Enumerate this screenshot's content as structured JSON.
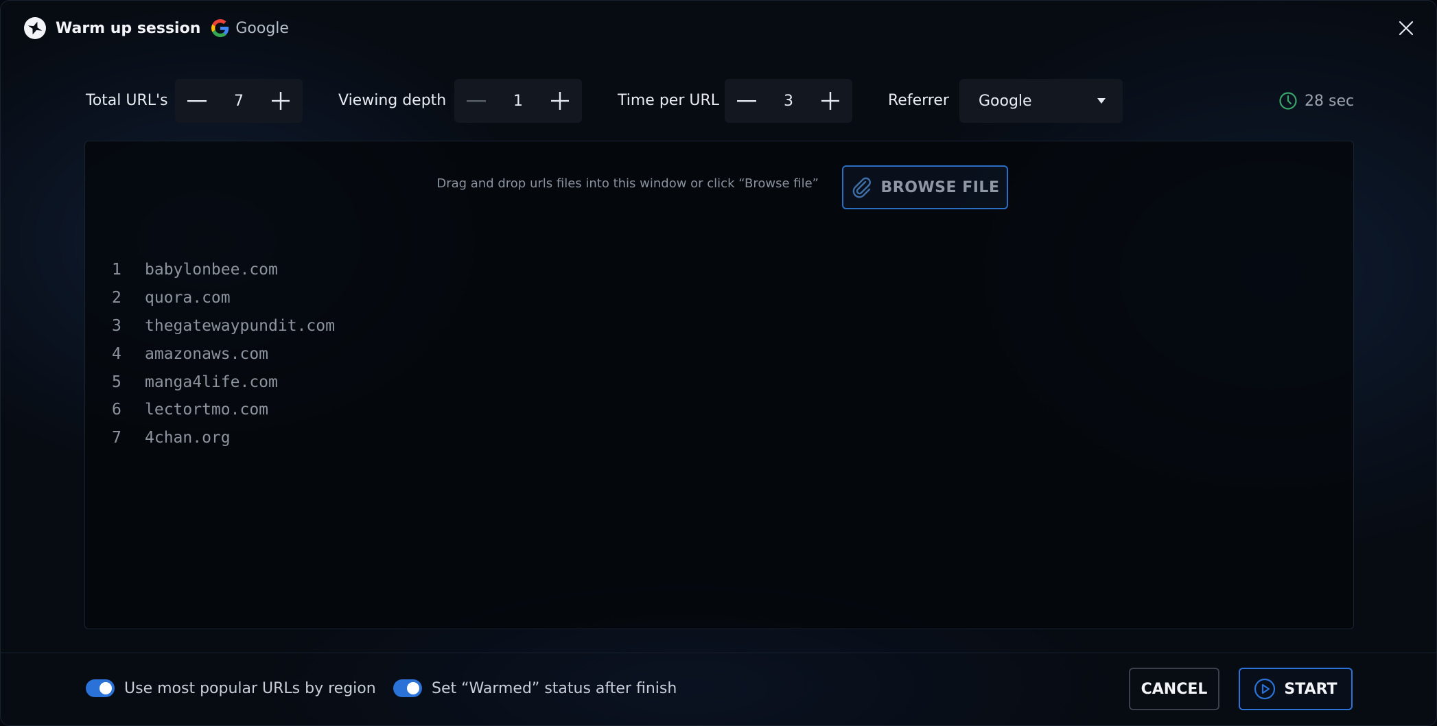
{
  "header": {
    "title": "Warm up session",
    "engine": "Google",
    "icons": {
      "app": "app-logo-icon",
      "engine": "google-logo-icon",
      "close": "close-icon"
    }
  },
  "controls": {
    "total_urls": {
      "label": "Total URL's",
      "value": "7"
    },
    "viewing_depth": {
      "label": "Viewing depth",
      "value": "1"
    },
    "time_per_url": {
      "label": "Time per URL",
      "value": "3"
    },
    "referrer": {
      "label": "Referrer",
      "selected": "Google"
    },
    "timer": "28 sec"
  },
  "dropzone": {
    "hint": "Drag and drop urls files into this window or click “Browse file”",
    "browse_label": "BROWSE FILE"
  },
  "urls": [
    {
      "n": "1",
      "url": "babylonbee.com"
    },
    {
      "n": "2",
      "url": "quora.com"
    },
    {
      "n": "3",
      "url": "thegatewaypundit.com"
    },
    {
      "n": "4",
      "url": "amazonaws.com"
    },
    {
      "n": "5",
      "url": "manga4life.com"
    },
    {
      "n": "6",
      "url": "lectortmo.com"
    },
    {
      "n": "7",
      "url": "4chan.org"
    }
  ],
  "footer": {
    "toggle_popular": {
      "label": "Use most popular URLs by region",
      "on": true
    },
    "toggle_warmed": {
      "label": "Set “Warmed” status after finish",
      "on": true
    },
    "cancel_label": "CANCEL",
    "start_label": "START"
  },
  "colors": {
    "accent": "#2a72d8",
    "timer": "#3aa56a",
    "background": "#070b12"
  }
}
